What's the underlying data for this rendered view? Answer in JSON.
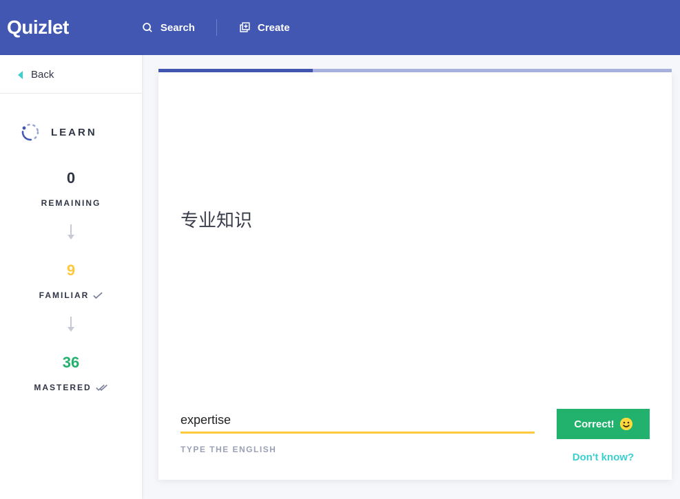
{
  "nav": {
    "logo": "Quizlet",
    "search": "Search",
    "create": "Create"
  },
  "sidebar": {
    "back": "Back",
    "learn_title": "LEARN",
    "remaining": {
      "count": "0",
      "label": "REMAINING"
    },
    "familiar": {
      "count": "9",
      "label": "FAMILIAR"
    },
    "mastered": {
      "count": "36",
      "label": "MASTERED"
    }
  },
  "card": {
    "prompt": "专业知识",
    "answer_value": "expertise",
    "input_hint": "TYPE THE ENGLISH",
    "correct_label": "Correct!",
    "dont_know": "Don't know?"
  }
}
